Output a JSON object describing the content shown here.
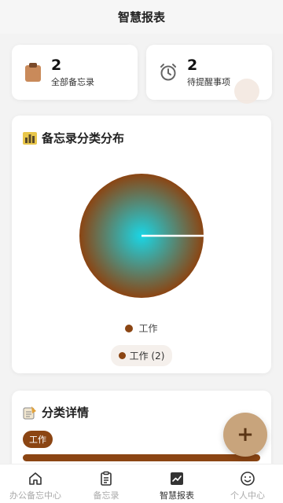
{
  "header": {
    "title": "智慧报表"
  },
  "stats": [
    {
      "value": "2",
      "label": "全部备忘录",
      "icon": "clipboard-icon"
    },
    {
      "value": "2",
      "label": "待提醒事项",
      "icon": "alarm-clock-icon"
    }
  ],
  "distribution": {
    "title": "备忘录分类分布",
    "icon": "bar-chart-icon",
    "legend_label": "工作",
    "chip_label": "工作 (2)"
  },
  "chart_data": {
    "type": "pie",
    "categories": [
      "工作"
    ],
    "values": [
      2
    ],
    "colors": [
      "#8b4513"
    ]
  },
  "details": {
    "title": "分类详情",
    "icon": "memo-icon",
    "tag": "工作",
    "bar_fraction": 1.0
  },
  "fab": {
    "label": "+"
  },
  "tabs": [
    {
      "label": "办公备忘中心",
      "icon": "home-icon",
      "active": false
    },
    {
      "label": "备忘录",
      "icon": "list-icon",
      "active": false
    },
    {
      "label": "智慧报表",
      "icon": "chart-icon",
      "active": true
    },
    {
      "label": "个人中心",
      "icon": "smiley-icon",
      "active": false
    }
  ],
  "colors": {
    "accent": "#8b4513",
    "fab": "#c8a47c",
    "pie_center": "#19d6e6"
  }
}
